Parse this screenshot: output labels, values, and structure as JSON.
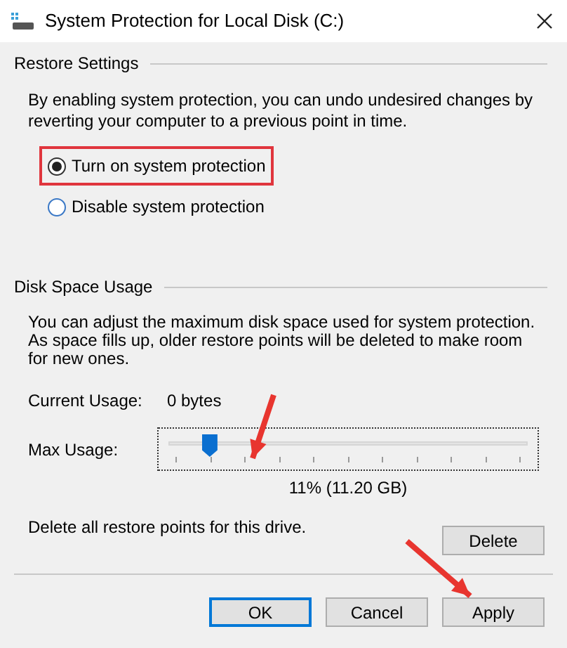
{
  "window": {
    "title": "System Protection for Local Disk (C:)"
  },
  "restore_settings": {
    "title": "Restore Settings",
    "description": "By enabling system protection, you can undo undesired changes by reverting your computer to a previous point in time.",
    "options": [
      {
        "label": "Turn on system protection",
        "selected": true,
        "highlighted": true
      },
      {
        "label": "Disable system protection",
        "selected": false,
        "highlighted": false
      }
    ]
  },
  "disk_space_usage": {
    "title": "Disk Space Usage",
    "description": "You can adjust the maximum disk space used for system protection. As space fills up, older restore points will be deleted to make room for new ones.",
    "current_usage_label": "Current Usage:",
    "current_usage_value": "0 bytes",
    "max_usage_label": "Max Usage:",
    "max_usage": {
      "level": 0.11,
      "reading": "11% (11.20 GB)"
    },
    "delete_text": "Delete all restore points for this drive.",
    "delete_button": "Delete"
  },
  "buttons": [
    {
      "label": "OK",
      "default": true
    },
    {
      "label": "Cancel",
      "default": false
    },
    {
      "label": "Apply",
      "default": false
    }
  ]
}
